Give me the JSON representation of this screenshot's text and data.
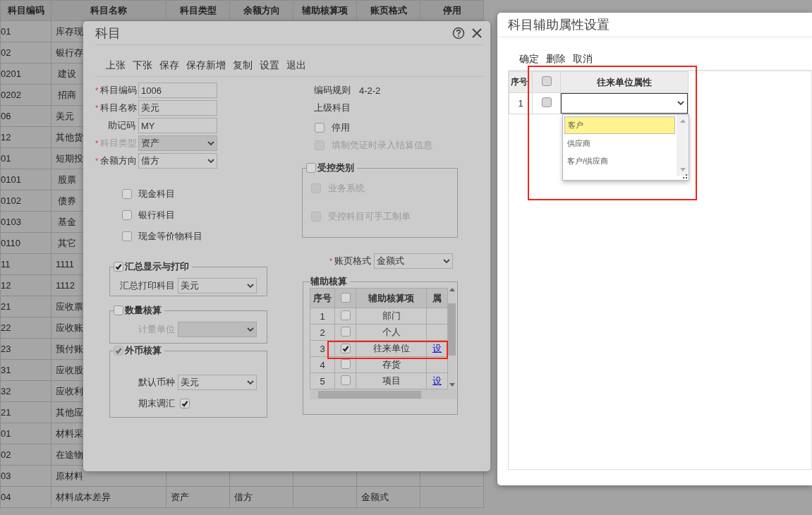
{
  "background_table": {
    "columns": [
      "科目编码",
      "科目名称",
      "科目类型",
      "余额方向",
      "辅助核算项",
      "账页格式",
      "停用"
    ],
    "rows": [
      {
        "code": "01",
        "name": "库存现",
        "indent": false
      },
      {
        "code": "02",
        "name": "银行存",
        "indent": false
      },
      {
        "code": "0201",
        "name": "建设",
        "indent": true
      },
      {
        "code": "0202",
        "name": "招商",
        "indent": true
      },
      {
        "code": "06",
        "name": "美元",
        "indent": false
      },
      {
        "code": "12",
        "name": "其他货",
        "indent": false
      },
      {
        "code": "01",
        "name": "短期投",
        "indent": false
      },
      {
        "code": "0101",
        "name": "股票",
        "indent": true
      },
      {
        "code": "0102",
        "name": "债券",
        "indent": true
      },
      {
        "code": "0103",
        "name": "基金",
        "indent": true
      },
      {
        "code": "0110",
        "name": "其它",
        "indent": true
      },
      {
        "code": "11",
        "name": "1111",
        "indent": false
      },
      {
        "code": "12",
        "name": "1112",
        "indent": false
      },
      {
        "code": "21",
        "name": "应收票",
        "indent": false
      },
      {
        "code": "22",
        "name": "应收账",
        "indent": false
      },
      {
        "code": "23",
        "name": "预付账",
        "indent": false
      },
      {
        "code": "31",
        "name": "应收股",
        "indent": false
      },
      {
        "code": "32",
        "name": "应收利",
        "indent": false
      },
      {
        "code": "21",
        "name": "其他应",
        "indent": false
      },
      {
        "code": "01",
        "name": "材料采",
        "indent": false
      },
      {
        "code": "02",
        "name": "在途物",
        "indent": false
      },
      {
        "code": "03",
        "name": "原材料",
        "indent": false
      },
      {
        "code": "04",
        "name": "材料成本差异",
        "indent": false,
        "type": "资产",
        "direction": "借方",
        "format": "金额式"
      }
    ]
  },
  "main_dialog": {
    "title": "科目",
    "toolbar": [
      "上张",
      "下张",
      "保存",
      "保存新增",
      "复制",
      "设置",
      "退出"
    ],
    "fields": [
      {
        "label": "科目编码",
        "required_mark": "*",
        "kind": "text",
        "value": "1006"
      },
      {
        "label": "科目名称",
        "required_mark": "*",
        "kind": "text",
        "value": "美元"
      },
      {
        "label": "助记码",
        "kind": "text",
        "value": "MY"
      },
      {
        "label": "科目类型",
        "required_mark": "*",
        "kind": "select",
        "value": "资产",
        "disabled": true
      },
      {
        "label": "余额方向",
        "required_mark": "*",
        "kind": "select",
        "value": "借方",
        "disabled": false
      }
    ],
    "flags": [
      {
        "label": "现金科目",
        "checked": false
      },
      {
        "label": "银行科目",
        "checked": false
      },
      {
        "label": "现金等价物科目",
        "checked": false
      }
    ],
    "groups": [
      {
        "legend": "汇总显示与打印",
        "checked": true,
        "disabled": false,
        "rows": [
          {
            "kind": "select",
            "label": "汇总打印科目",
            "value": "美元",
            "disabled": false
          }
        ]
      },
      {
        "legend": "数量核算",
        "checked": false,
        "disabled": false,
        "rows": [
          {
            "kind": "select",
            "label": "计量单位",
            "disabled": true
          }
        ]
      },
      {
        "legend": "外币核算",
        "checked": true,
        "disabled": true,
        "rows": [
          {
            "kind": "select",
            "label": "默认币种",
            "value": "美元",
            "disabled": false
          },
          {
            "kind": "check",
            "label": "期末调汇",
            "checked": true
          }
        ]
      }
    ],
    "code_rule": {
      "label": "编码规则",
      "value": "4-2-2"
    },
    "parent_label": "上级科目",
    "right_flags": [
      {
        "label": "停用",
        "checked": false,
        "disabled": false
      },
      {
        "label": "填制凭证时录入结算信息",
        "checked": false,
        "disabled": true
      }
    ],
    "control_group": {
      "legend": "受控类别",
      "checked": false,
      "items": [
        {
          "label": "业务系统",
          "checked": false,
          "disabled": true
        },
        {
          "label": "受控科目可手工制单",
          "checked": false,
          "disabled": true
        }
      ]
    },
    "ledger_format": {
      "label": "账页格式",
      "required_mark": "*",
      "value": "金额式"
    },
    "aux": {
      "legend": "辅助核算",
      "columns": [
        "序号",
        "辅助核算项",
        "属"
      ],
      "all_checked": false,
      "rows": [
        {
          "index": "1",
          "item": "部门",
          "checked": false
        },
        {
          "index": "2",
          "item": "个人",
          "checked": false
        },
        {
          "index": "3",
          "item": "往来单位",
          "checked": true,
          "link": "设"
        },
        {
          "index": "4",
          "item": "存货",
          "checked": false
        },
        {
          "index": "5",
          "item": "项目",
          "checked": false,
          "link": "设"
        }
      ]
    }
  },
  "attr_dialog": {
    "title": "科目辅助属性设置",
    "toolbar": [
      "确定",
      "删除",
      "取消"
    ],
    "columns": [
      "序号",
      "往来单位属性"
    ],
    "all_checked": false,
    "rows": [
      {
        "index": "1",
        "checked": false
      }
    ],
    "dropdown": {
      "options": [
        {
          "label": "客户",
          "selected": true
        },
        {
          "label": "供应商",
          "selected": false
        },
        {
          "label": "客户/供应商",
          "selected": false
        }
      ]
    }
  }
}
